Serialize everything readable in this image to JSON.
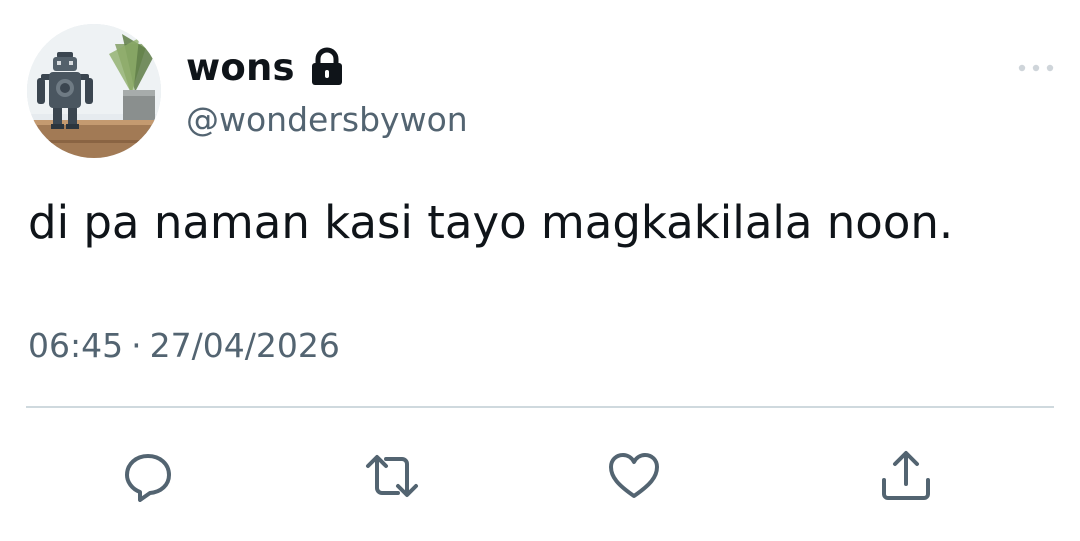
{
  "user": {
    "display_name": "wons",
    "handle": "@wondersbywon",
    "protected_icon": "lock-icon",
    "avatar_icon": "robot-figurine-photo"
  },
  "tweet": {
    "text": "di pa naman kasi tayo magkakilala noon.",
    "time": "06:45",
    "separator": "·",
    "date": "27/04/2026"
  },
  "actions": {
    "reply_icon": "reply-icon",
    "retweet_icon": "retweet-icon",
    "like_icon": "heart-icon",
    "share_icon": "share-icon",
    "more_icon": "more-icon"
  },
  "colors": {
    "text_primary": "#0f1419",
    "text_secondary": "#536471",
    "divider": "#cfd9de"
  }
}
